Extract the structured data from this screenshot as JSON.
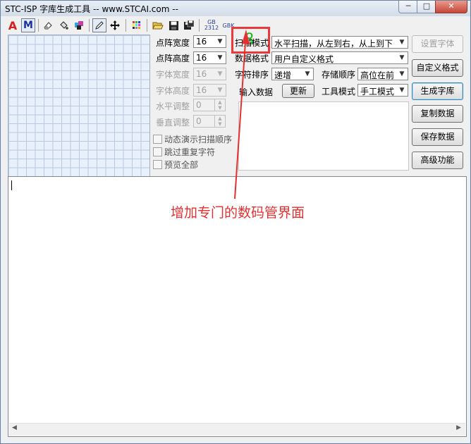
{
  "window": {
    "title": "STC-ISP 字库生成工具 -- www.STCAI.com --",
    "min_glyph": "─",
    "max_glyph": "□",
    "close_glyph": "✕"
  },
  "toolbar": {
    "font_a": "A",
    "font_m": "M",
    "gb2312_top": "GB",
    "gb2312_bottom": "2312",
    "gbk": "GBK"
  },
  "left_panel": {
    "dot_width_label": "点阵宽度",
    "dot_width_value": "16",
    "dot_height_label": "点阵高度",
    "dot_height_value": "16",
    "font_width_label": "字体宽度",
    "font_width_value": "16",
    "font_height_label": "字体高度",
    "font_height_value": "16",
    "h_adjust_label": "水平调整",
    "h_adjust_value": "0",
    "v_adjust_label": "垂直调整",
    "v_adjust_value": "0",
    "chk_animate": "动态演示扫描顺序",
    "chk_skip_dup": "跳过重复字符",
    "chk_preview_all": "预览全部"
  },
  "right_panel": {
    "scan_mode_label": "扫描模式",
    "scan_mode_value": "水平扫描，从左到右，从上到下",
    "data_format_label": "数据格式",
    "data_format_value": "用户自定义格式",
    "char_order_label": "字符排序",
    "char_order_value": "递增",
    "storage_order_label": "存储顺序",
    "storage_order_value": "高位在前",
    "input_data_label": "输入数据",
    "update_button": "更新",
    "tool_mode_label": "工具模式",
    "tool_mode_value": "手工模式"
  },
  "buttons": {
    "set_font": "设置字体",
    "custom_format": "自定义格式",
    "generate": "生成字库",
    "copy_data": "复制数据",
    "save_data": "保存数据",
    "advanced": "高级功能"
  },
  "seven_segment": {
    "digit": "8"
  },
  "annotation": {
    "text": "增加专门的数码管界面",
    "color": "#e53030"
  }
}
